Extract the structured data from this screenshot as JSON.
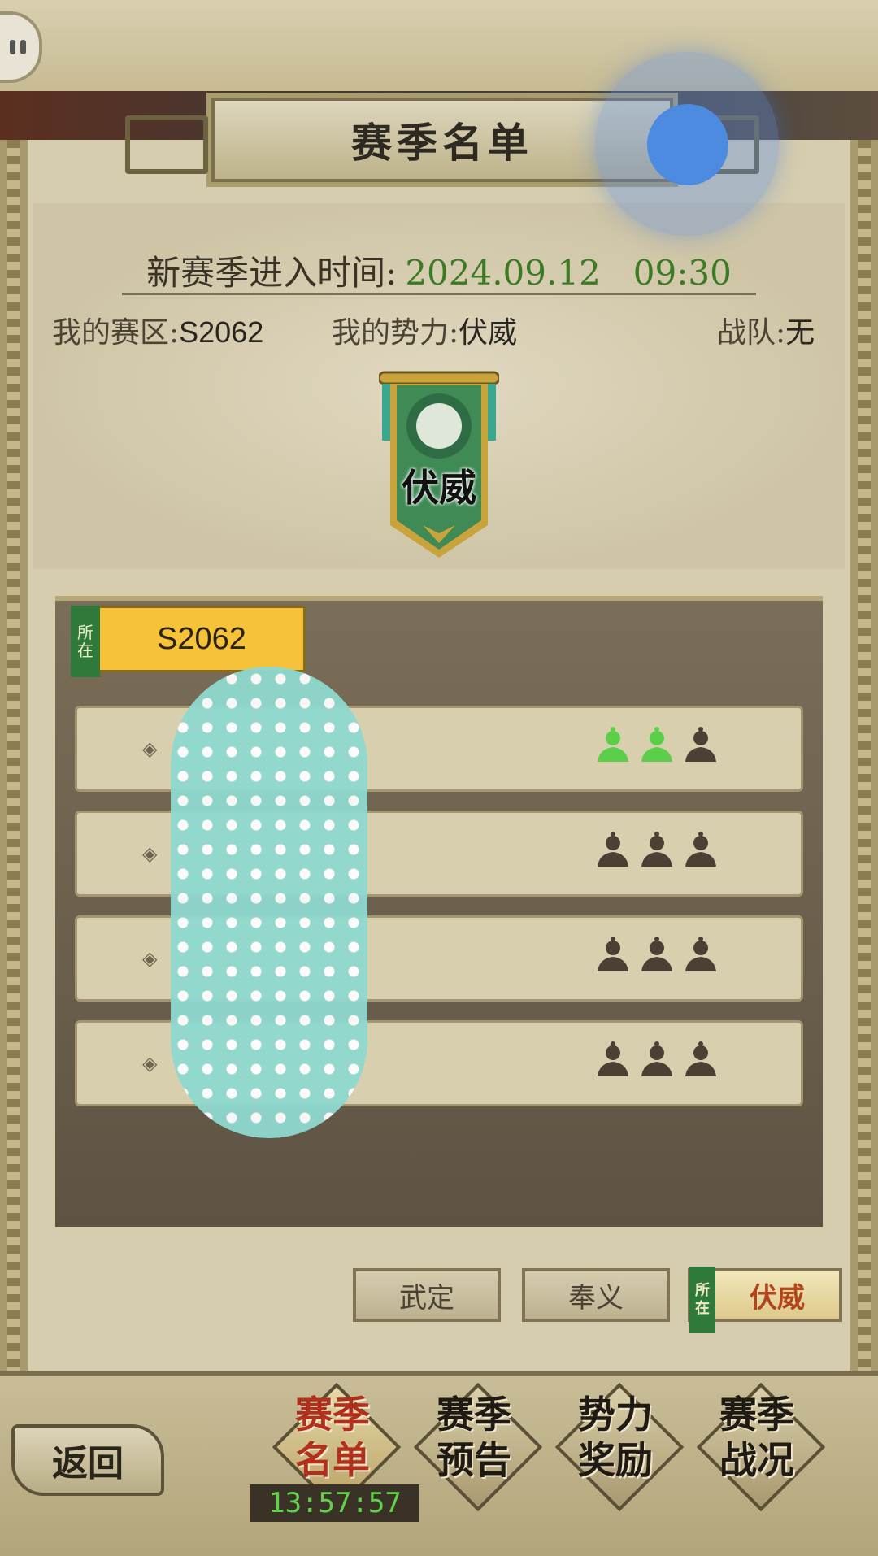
{
  "title": "赛季名单",
  "season": {
    "enter_label": "新赛季进入时间:",
    "date": "2024.09.12",
    "time": "09:30"
  },
  "meta": {
    "zone_label": "我的赛区:",
    "zone_value": "S2062",
    "faction_label": "我的势力:",
    "faction_value": "伏威",
    "team_label": "战队:",
    "team_value": "无"
  },
  "banner_text": "伏威",
  "zone_tag": {
    "flag": "所在",
    "label": "S2062"
  },
  "rows": [
    {
      "active_slots": 2,
      "total_slots": 3
    },
    {
      "active_slots": 0,
      "total_slots": 3
    },
    {
      "active_slots": 0,
      "total_slots": 3
    },
    {
      "active_slots": 0,
      "total_slots": 3
    }
  ],
  "factions": [
    {
      "label": "武定",
      "active": false
    },
    {
      "label": "奉义",
      "active": false
    },
    {
      "label": "伏威",
      "active": true,
      "flag": "所在"
    }
  ],
  "nav": {
    "back": "返回",
    "items": [
      {
        "line1": "赛季",
        "line2": "名单",
        "active": true
      },
      {
        "line1": "赛季",
        "line2": "预告",
        "active": false
      },
      {
        "line1": "势力",
        "line2": "奖励",
        "active": false
      },
      {
        "line1": "赛季",
        "line2": "战况",
        "active": false
      }
    ],
    "timer": "13:57:57"
  },
  "colors": {
    "accent_green": "#3d7a24",
    "active_red": "#b0301c",
    "tag_yellow": "#f5c23a",
    "slot_active": "#5ccf4a",
    "slot_inactive": "#4a4034"
  }
}
